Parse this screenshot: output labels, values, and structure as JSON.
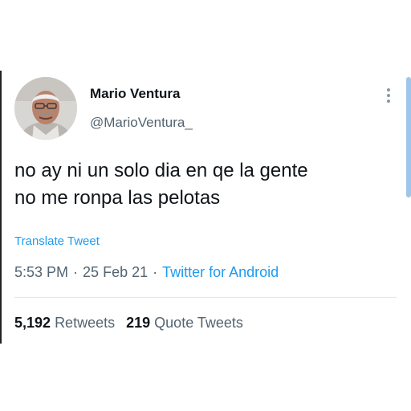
{
  "user": {
    "display_name": "Mario Ventura",
    "handle": "@MarioVentura_",
    "avatar_icon": "profile-photo"
  },
  "tweet": {
    "text_lines": [
      "no ay ni un solo dia en qe la gente",
      "no me ronpa las pelotas"
    ],
    "translate_label": "Translate Tweet",
    "time": "5:53 PM",
    "date": "25 Feb 21",
    "source": "Twitter for Android",
    "separator": "·"
  },
  "stats": {
    "retweets_count": "5,192",
    "retweets_label": "Retweets",
    "quotes_count": "219",
    "quotes_label": "Quote Tweets"
  },
  "colors": {
    "link": "#1d9bf0",
    "secondary_text": "#536471",
    "primary_text": "#0f1419"
  }
}
